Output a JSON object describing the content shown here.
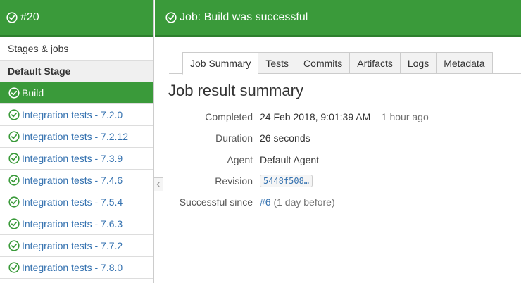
{
  "sidebar": {
    "build_number": "#20",
    "title": "Stages & jobs",
    "stage_name": "Default Stage",
    "jobs": [
      {
        "label": "Build",
        "active": true
      },
      {
        "label": "Integration tests - 7.2.0",
        "active": false
      },
      {
        "label": "Integration tests - 7.2.12",
        "active": false
      },
      {
        "label": "Integration tests - 7.3.9",
        "active": false
      },
      {
        "label": "Integration tests - 7.4.6",
        "active": false
      },
      {
        "label": "Integration tests - 7.5.4",
        "active": false
      },
      {
        "label": "Integration tests - 7.6.3",
        "active": false
      },
      {
        "label": "Integration tests - 7.7.2",
        "active": false
      },
      {
        "label": "Integration tests - 7.8.0",
        "active": false
      }
    ]
  },
  "header": {
    "title": "Job: Build was successful"
  },
  "tabs": [
    {
      "label": "Job Summary",
      "active": true
    },
    {
      "label": "Tests",
      "active": false
    },
    {
      "label": "Commits",
      "active": false
    },
    {
      "label": "Artifacts",
      "active": false
    },
    {
      "label": "Logs",
      "active": false
    },
    {
      "label": "Metadata",
      "active": false
    }
  ],
  "main": {
    "title": "Job result summary",
    "completed_label": "Completed",
    "completed_value": "24 Feb 2018, 9:01:39 AM –",
    "completed_relative": "1 hour ago",
    "duration_label": "Duration",
    "duration_value": "26 seconds",
    "agent_label": "Agent",
    "agent_value": "Default Agent",
    "revision_label": "Revision",
    "revision_value": "5448f508…",
    "successful_since_label": "Successful since",
    "successful_since_link": "#6",
    "successful_since_note": "(1 day before)"
  },
  "icons": {
    "success": "check-circle-icon",
    "collapse": "chevron-left-icon"
  },
  "colors": {
    "success_green": "#3a9a3a",
    "link_blue": "#3572b0"
  }
}
